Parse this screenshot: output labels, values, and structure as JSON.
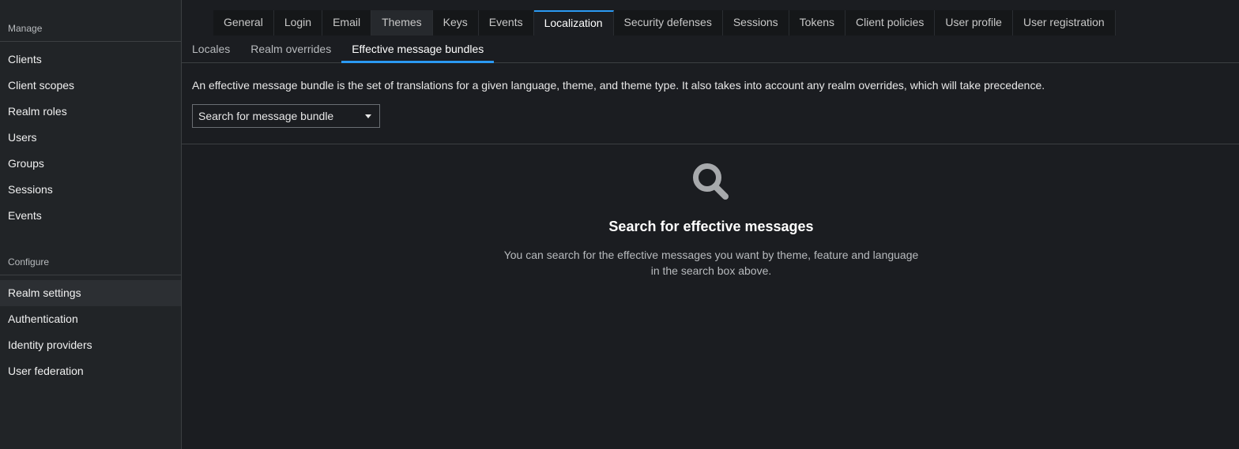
{
  "sidebar": {
    "manage_title": "Manage",
    "manage_items": [
      {
        "label": "Clients"
      },
      {
        "label": "Client scopes"
      },
      {
        "label": "Realm roles"
      },
      {
        "label": "Users"
      },
      {
        "label": "Groups"
      },
      {
        "label": "Sessions"
      },
      {
        "label": "Events"
      }
    ],
    "configure_title": "Configure",
    "configure_items": [
      {
        "label": "Realm settings",
        "active": true
      },
      {
        "label": "Authentication"
      },
      {
        "label": "Identity providers"
      },
      {
        "label": "User federation"
      }
    ]
  },
  "tabs": [
    {
      "label": "General"
    },
    {
      "label": "Login"
    },
    {
      "label": "Email"
    },
    {
      "label": "Themes"
    },
    {
      "label": "Keys"
    },
    {
      "label": "Events"
    },
    {
      "label": "Localization",
      "selected": true
    },
    {
      "label": "Security defenses"
    },
    {
      "label": "Sessions"
    },
    {
      "label": "Tokens"
    },
    {
      "label": "Client policies"
    },
    {
      "label": "User profile"
    },
    {
      "label": "User registration"
    }
  ],
  "subtabs": [
    {
      "label": "Locales"
    },
    {
      "label": "Realm overrides"
    },
    {
      "label": "Effective message bundles",
      "selected": true
    }
  ],
  "content": {
    "description": "An effective message bundle is the set of translations for a given language, theme, and theme type. It also takes into account any realm overrides, which will take precedence.",
    "search_select": {
      "value": "Search for message bundle"
    },
    "empty_state": {
      "icon": "search-icon",
      "title": "Search for effective messages",
      "body_line1": "You can search for the effective messages you want by theme, feature and language",
      "body_line2": "in the search box above."
    }
  },
  "colors": {
    "accent": "#2b9af3",
    "background": "#1b1d21",
    "sidebar_bg": "#212427"
  }
}
